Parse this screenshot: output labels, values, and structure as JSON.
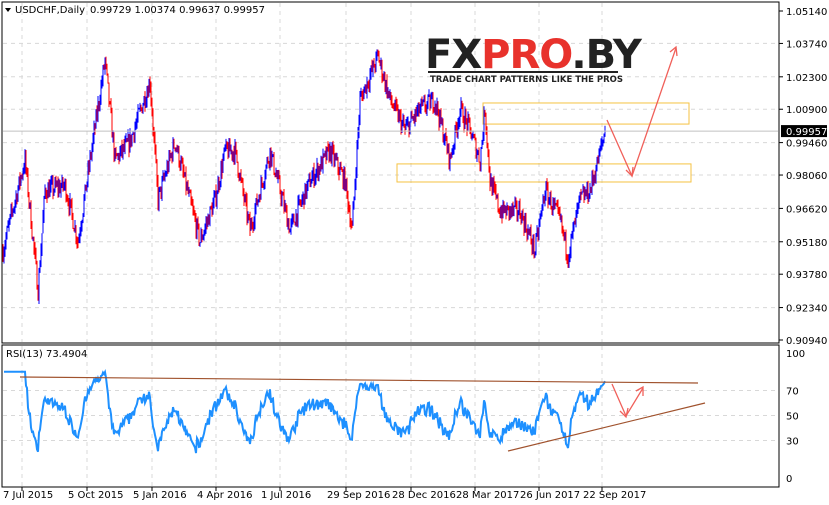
{
  "header": {
    "symbol_label": "USDCHF,Daily",
    "ohlc": "0.99729 1.00374 0.99637 0.99957"
  },
  "logo": {
    "title": "FXPRO.BY",
    "tagline": "TRADE CHART PATTERNS LIKE THE PROS"
  },
  "rsi_pane": {
    "label": "RSI(13) 73.4904"
  },
  "colors": {
    "up": "#0000ff",
    "down": "#ff0000",
    "rsi": "#1e90ff",
    "zone": "#f5c242",
    "arrow": "#f0605a",
    "trend": "#a0522d"
  },
  "chart_data": [
    {
      "type": "line",
      "title": "USDCHF,Daily",
      "subtype": "ohlc-bars",
      "price_ticks": [
        "1.05140",
        "1.03740",
        "1.02300",
        "1.00900",
        "0.99460",
        "0.98060",
        "0.96620",
        "0.95180",
        "0.93780",
        "0.92340",
        "0.90940"
      ],
      "ylim": [
        0.9094,
        1.0514
      ],
      "current_price": "0.99957",
      "x_tick_labels": [
        "7 Jul 2015",
        "5 Oct 2015",
        "5 Jan 2016",
        "4 Apr 2016",
        "1 Jul 2016",
        "29 Sep 2016",
        "28 Dec 2016",
        "28 Mar 2017",
        "26 Jun 2017",
        "22 Sep 2017"
      ],
      "approx_close_path": [
        [
          0,
          0.948
        ],
        [
          7,
          0.961
        ],
        [
          22,
          0.987
        ],
        [
          35,
          0.931
        ],
        [
          42,
          0.974
        ],
        [
          62,
          0.976
        ],
        [
          75,
          0.952
        ],
        [
          87,
          0.987
        ],
        [
          102,
          1.03
        ],
        [
          112,
          0.987
        ],
        [
          127,
          0.995
        ],
        [
          147,
          1.021
        ],
        [
          155,
          0.97
        ],
        [
          172,
          0.995
        ],
        [
          197,
          0.952
        ],
        [
          212,
          0.97
        ],
        [
          222,
          0.991
        ],
        [
          232,
          0.991
        ],
        [
          247,
          0.957
        ],
        [
          267,
          0.991
        ],
        [
          287,
          0.957
        ],
        [
          307,
          0.978
        ],
        [
          327,
          0.991
        ],
        [
          342,
          0.978
        ],
        [
          349,
          0.957
        ],
        [
          357,
          1.013
        ],
        [
          375,
          1.032
        ],
        [
          387,
          1.013
        ],
        [
          402,
          1.0
        ],
        [
          417,
          1.009
        ],
        [
          432,
          1.013
        ],
        [
          447,
          0.987
        ],
        [
          457,
          1.009
        ],
        [
          467,
          1.0
        ],
        [
          477,
          0.987
        ],
        [
          482,
          1.009
        ],
        [
          487,
          0.978
        ],
        [
          497,
          0.965
        ],
        [
          517,
          0.965
        ],
        [
          532,
          0.948
        ],
        [
          542,
          0.974
        ],
        [
          557,
          0.961
        ],
        [
          565,
          0.946
        ],
        [
          577,
          0.97
        ],
        [
          587,
          0.974
        ],
        [
          595,
          0.987
        ],
        [
          602,
          0.99957
        ]
      ],
      "zones": [
        {
          "top": 1.0117,
          "bottom": 1.0026
        },
        {
          "top": 0.9854,
          "bottom": 0.9776
        }
      ]
    },
    {
      "type": "line",
      "title": "RSI(13)",
      "value": 73.4904,
      "y_ticks": [
        "100",
        "70",
        "50",
        "30",
        "0"
      ],
      "ylim": [
        0,
        100
      ]
    }
  ]
}
